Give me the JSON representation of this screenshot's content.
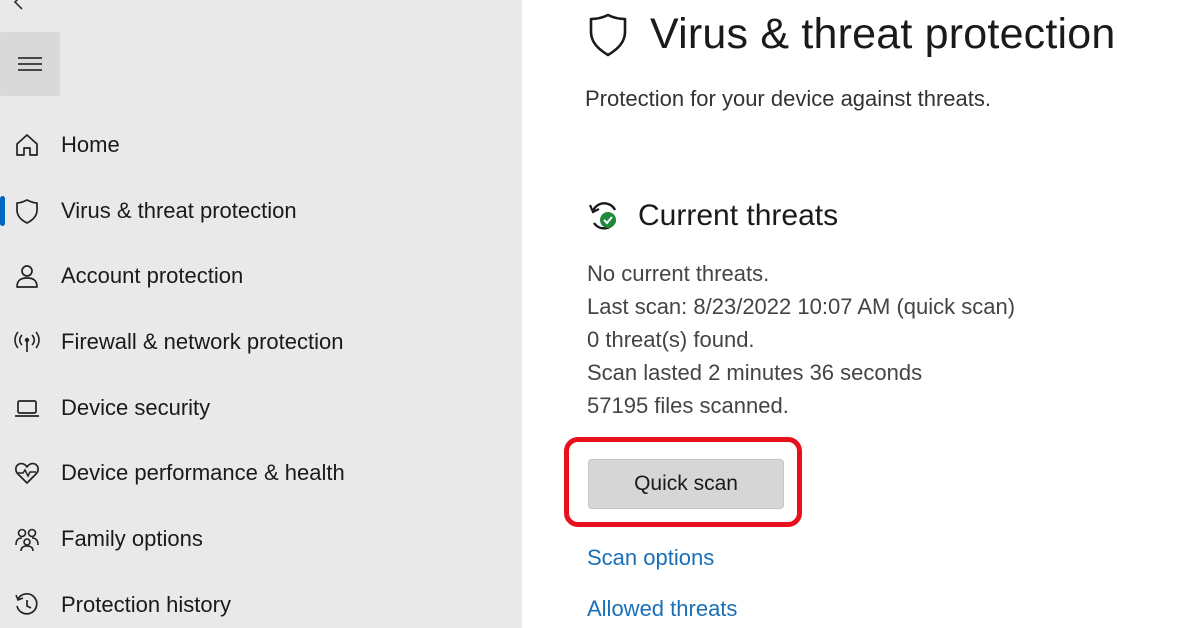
{
  "sidebar": {
    "items": [
      {
        "label": "Home",
        "icon": "home-icon",
        "active": false
      },
      {
        "label": "Virus & threat protection",
        "icon": "shield-icon",
        "active": true
      },
      {
        "label": "Account protection",
        "icon": "person-icon",
        "active": false
      },
      {
        "label": "Firewall & network protection",
        "icon": "wifi-antenna-icon",
        "active": false
      },
      {
        "label": "Device security",
        "icon": "laptop-icon",
        "active": false
      },
      {
        "label": "Device performance & health",
        "icon": "heart-pulse-icon",
        "active": false
      },
      {
        "label": "Family options",
        "icon": "family-icon",
        "active": false
      },
      {
        "label": "Protection history",
        "icon": "history-icon",
        "active": false
      }
    ]
  },
  "main": {
    "title": "Virus & threat protection",
    "subtitle": "Protection for your device against threats.",
    "current_threats": {
      "heading": "Current threats",
      "status": "No current threats.",
      "last_scan": "Last scan: 8/23/2022 10:07 AM (quick scan)",
      "threats_found": "0 threat(s) found.",
      "duration": "Scan lasted 2 minutes 36 seconds",
      "files_scanned": "57195 files scanned.",
      "quick_scan_label": "Quick scan",
      "scan_options_label": "Scan options",
      "allowed_threats_label": "Allowed threats"
    }
  },
  "colors": {
    "sidebar_bg": "#e9e9e9",
    "accent": "#0067c0",
    "link": "#1a6fb8",
    "highlight": "#e8101c",
    "check_green": "#1f8a3c"
  }
}
